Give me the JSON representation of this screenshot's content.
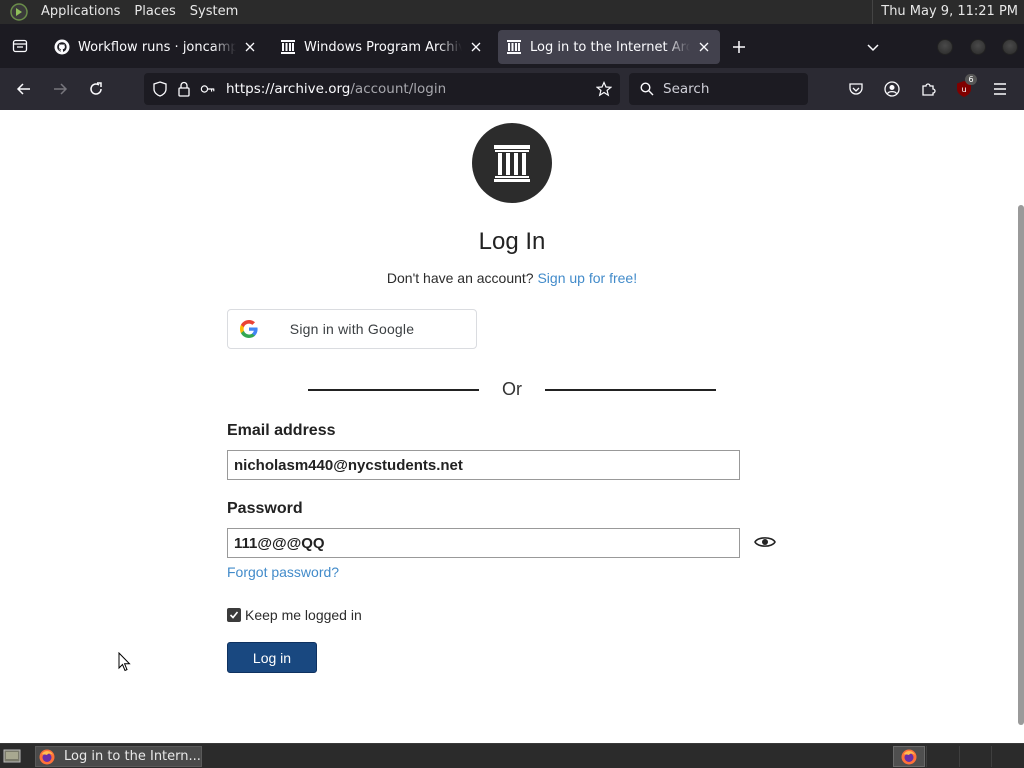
{
  "top_panel": {
    "menus": [
      "Applications",
      "Places",
      "System"
    ],
    "clock": "Thu May  9, 11:21 PM"
  },
  "tabs": [
    {
      "title": "Workflow runs · joncampbell",
      "icon": "github-icon",
      "active": false
    },
    {
      "title": "Windows Program Archive",
      "icon": "archive-icon",
      "active": false
    },
    {
      "title": "Log in to the Internet Archive",
      "icon": "archive-icon",
      "active": true
    }
  ],
  "navbar": {
    "url_host": "https://archive.org",
    "url_path": "/account/login",
    "search_placeholder": "Search",
    "ublock_badge": "6"
  },
  "page": {
    "heading": "Log In",
    "no_account_text": "Don't have an account?",
    "signup_link": "Sign up for free!",
    "google_button": "Sign in with Google",
    "or_text": "Or",
    "email_label": "Email address",
    "email_value": "nicholasm440@nycstudents.net",
    "password_label": "Password",
    "password_value": "111@@@QQ",
    "forgot_link": "Forgot password?",
    "keep_logged_in": "Keep me logged in",
    "keep_logged_in_checked": true,
    "login_button": "Log in"
  },
  "taskbar": {
    "window_title": "Log in to the Intern..."
  },
  "colors": {
    "link": "#428bca",
    "login_button": "#194880",
    "logo_bg": "#2c2c2c"
  }
}
